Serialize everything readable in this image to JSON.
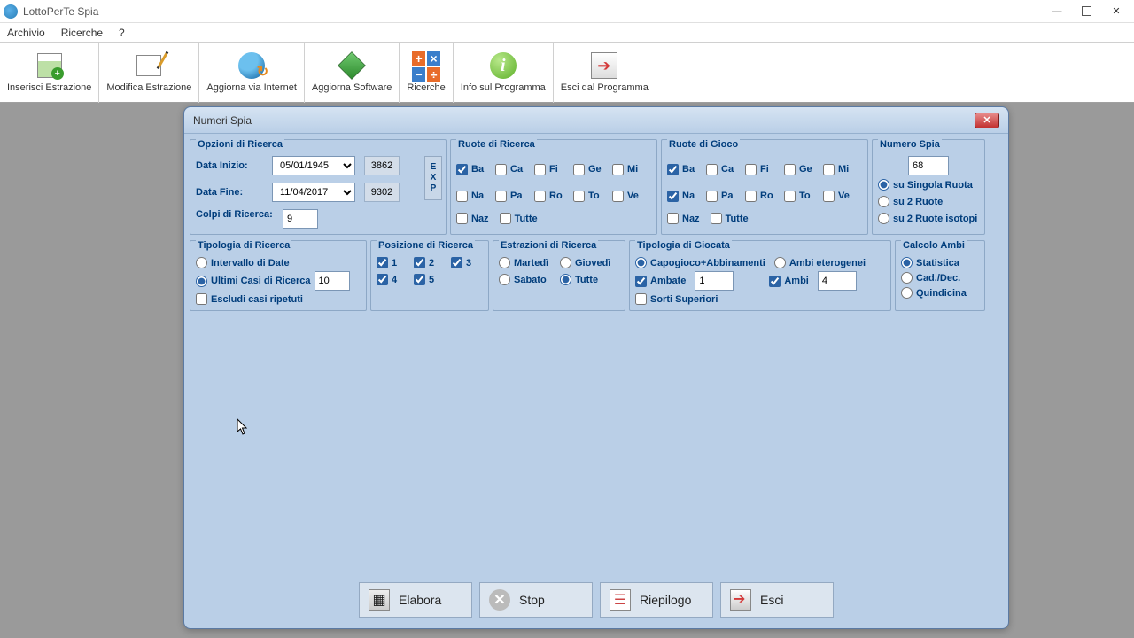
{
  "app": {
    "title": "LottoPerTe Spia"
  },
  "menu": {
    "archivio": "Archivio",
    "ricerche": "Ricerche",
    "help": "?"
  },
  "toolbar": {
    "inserisci": "Inserisci Estrazione",
    "modifica": "Modifica Estrazione",
    "aggiorna_net": "Aggiorna via Internet",
    "aggiorna_soft": "Aggiorna Software",
    "ricerche": "Ricerche",
    "info": "Info sul Programma",
    "esci": "Esci dal Programma"
  },
  "dialog": {
    "title": "Numeri Spia",
    "opzioni": {
      "legend": "Opzioni di Ricerca",
      "data_inizio_label": "Data Inizio:",
      "data_inizio": "05/01/1945",
      "data_inizio_n": "3862",
      "data_fine_label": "Data Fine:",
      "data_fine": "11/04/2017",
      "data_fine_n": "9302",
      "colpi_label": "Colpi di Ricerca:",
      "colpi": "9",
      "exp": "E\nX\nP"
    },
    "ruote_ricerca": {
      "legend": "Ruote di Ricerca",
      "ba": "Ba",
      "ca": "Ca",
      "fi": "Fi",
      "ge": "Ge",
      "mi": "Mi",
      "na": "Na",
      "pa": "Pa",
      "ro": "Ro",
      "to": "To",
      "ve": "Ve",
      "naz": "Naz",
      "tutte": "Tutte"
    },
    "ruote_gioco": {
      "legend": "Ruote di Gioco",
      "ba": "Ba",
      "ca": "Ca",
      "fi": "Fi",
      "ge": "Ge",
      "mi": "Mi",
      "na": "Na",
      "pa": "Pa",
      "ro": "Ro",
      "to": "To",
      "ve": "Ve",
      "naz": "Naz",
      "tutte": "Tutte"
    },
    "numero_spia": {
      "legend": "Numero Spia",
      "value": "68",
      "singola": "su Singola Ruota",
      "due": "su 2 Ruote",
      "isotopi": "su 2 Ruote isotopi"
    },
    "tipologia_ricerca": {
      "legend": "Tipologia di Ricerca",
      "intervallo": "Intervallo di Date",
      "ultimi": "Ultimi Casi di Ricerca",
      "ultimi_val": "10",
      "escludi": "Escludi casi ripetuti"
    },
    "posizione": {
      "legend": "Posizione di Ricerca",
      "p1": "1",
      "p2": "2",
      "p3": "3",
      "p4": "4",
      "p5": "5"
    },
    "estrazioni": {
      "legend": "Estrazioni di Ricerca",
      "martedi": "Martedì",
      "giovedi": "Giovedì",
      "sabato": "Sabato",
      "tutte": "Tutte"
    },
    "tipologia_giocata": {
      "legend": "Tipologia di Giocata",
      "capo": "Capogioco+Abbinamenti",
      "etero": "Ambi eterogenei",
      "ambate": "Ambate",
      "ambate_val": "1",
      "ambi": "Ambi",
      "ambi_val": "4",
      "sorti": "Sorti Superiori"
    },
    "calcolo": {
      "legend": "Calcolo Ambi",
      "stat": "Statistica",
      "cad": "Cad./Dec.",
      "quin": "Quindicina"
    },
    "buttons": {
      "elabora": "Elabora",
      "stop": "Stop",
      "riepilogo": "Riepilogo",
      "esci": "Esci"
    }
  }
}
